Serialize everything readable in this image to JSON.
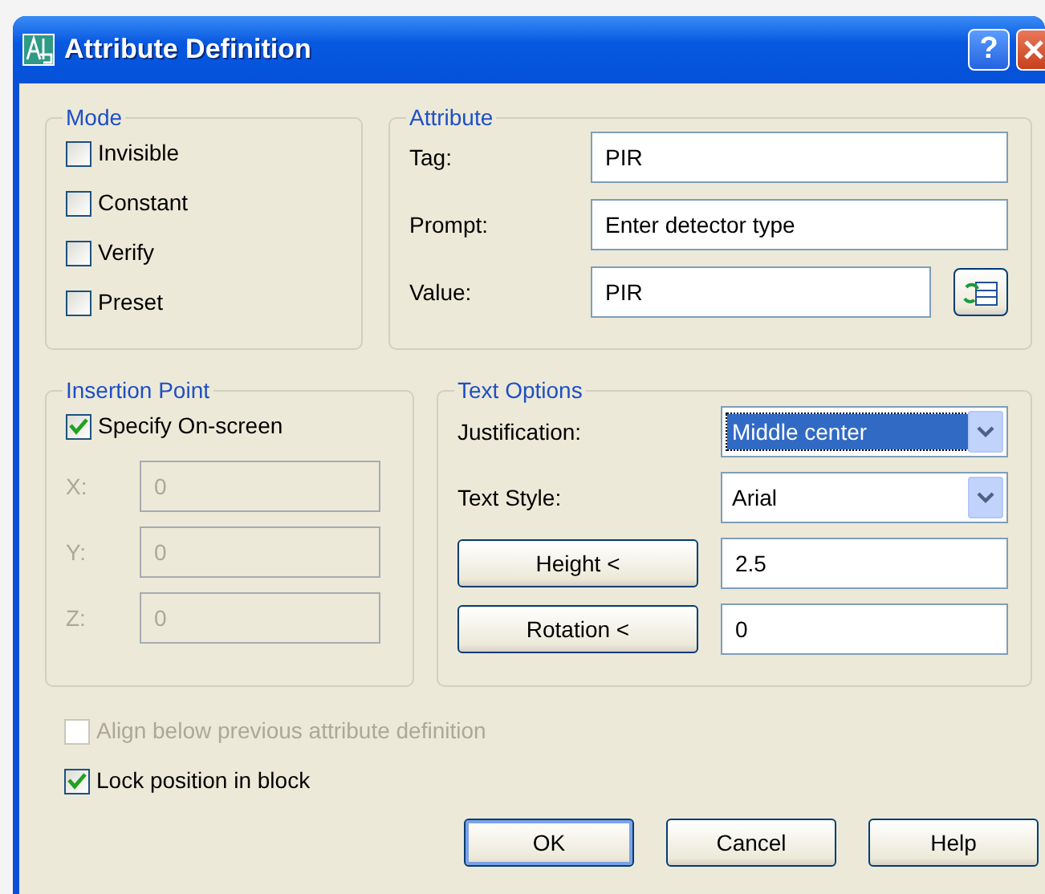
{
  "window": {
    "title": "Attribute Definition",
    "help_button": "?"
  },
  "mode": {
    "title": "Mode",
    "options": [
      {
        "label": "Invisible",
        "checked": false
      },
      {
        "label": "Constant",
        "checked": false
      },
      {
        "label": "Verify",
        "checked": false
      },
      {
        "label": "Preset",
        "checked": false
      }
    ]
  },
  "attribute": {
    "title": "Attribute",
    "fields": [
      {
        "label": "Tag:",
        "value": "PIR"
      },
      {
        "label": "Prompt:",
        "value": "Enter detector type"
      },
      {
        "label": "Value:",
        "value": "PIR"
      }
    ]
  },
  "insertion_point": {
    "title": "Insertion Point",
    "specify_on_screen": {
      "label": "Specify On-screen",
      "checked": true
    },
    "coordinates": [
      {
        "label": "X:",
        "value": "0",
        "disabled": true
      },
      {
        "label": "Y:",
        "value": "0",
        "disabled": true
      },
      {
        "label": "Z:",
        "value": "0",
        "disabled": true
      }
    ]
  },
  "text_options": {
    "title": "Text Options",
    "rows": [
      {
        "kind": "select",
        "label": "Justification:",
        "value": "Middle center",
        "focused": true
      },
      {
        "kind": "select",
        "label": "Text Style:",
        "value": "Arial",
        "focused": false
      },
      {
        "kind": "pick",
        "button": "Height <",
        "value": "2.5"
      },
      {
        "kind": "pick",
        "button": "Rotation <",
        "value": "0"
      }
    ]
  },
  "options": [
    {
      "label": "Align below previous attribute definition",
      "checked": false,
      "disabled": true
    },
    {
      "label": "Lock position in block",
      "checked": true,
      "disabled": false
    }
  ],
  "buttons": [
    {
      "label": "OK",
      "default": true
    },
    {
      "label": "Cancel",
      "default": false
    },
    {
      "label": "Help",
      "default": false
    }
  ]
}
